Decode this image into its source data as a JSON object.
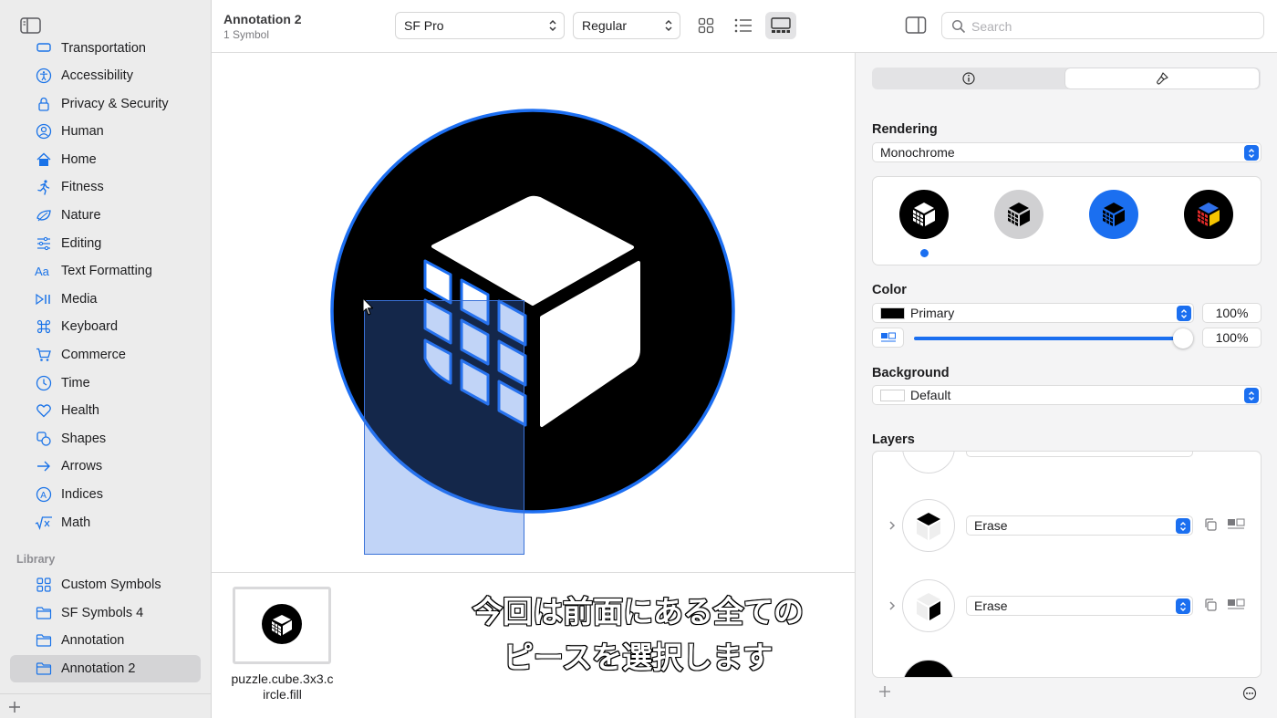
{
  "colors": {
    "accent": "#1b6ff0",
    "sidebar_bg": "#ececec",
    "selection": "#d4d4d6"
  },
  "sidebar": {
    "top_partial_label": "Transportation",
    "categories": [
      {
        "label": "Accessibility",
        "icon": "accessibility-icon"
      },
      {
        "label": "Privacy & Security",
        "icon": "lock-icon"
      },
      {
        "label": "Human",
        "icon": "person-circle-icon"
      },
      {
        "label": "Home",
        "icon": "house-icon"
      },
      {
        "label": "Fitness",
        "icon": "figure-run-icon"
      },
      {
        "label": "Nature",
        "icon": "leaf-icon"
      },
      {
        "label": "Editing",
        "icon": "sliders-icon"
      },
      {
        "label": "Text Formatting",
        "icon": "textformat-icon"
      },
      {
        "label": "Media",
        "icon": "playpause-icon"
      },
      {
        "label": "Keyboard",
        "icon": "command-icon"
      },
      {
        "label": "Commerce",
        "icon": "cart-icon"
      },
      {
        "label": "Time",
        "icon": "clock-icon"
      },
      {
        "label": "Health",
        "icon": "heart-icon"
      },
      {
        "label": "Shapes",
        "icon": "shapes-icon"
      },
      {
        "label": "Arrows",
        "icon": "arrow-right-icon"
      },
      {
        "label": "Indices",
        "icon": "a-circle-icon"
      },
      {
        "label": "Math",
        "icon": "sqrt-icon"
      }
    ],
    "library_header": "Library",
    "library": [
      {
        "label": "Custom Symbols",
        "icon": "grid-icon"
      },
      {
        "label": "SF Symbols 4",
        "icon": "folder-icon"
      },
      {
        "label": "Annotation",
        "icon": "folder-icon"
      },
      {
        "label": "Annotation 2",
        "icon": "folder-icon",
        "selected": true
      }
    ]
  },
  "toolbar": {
    "title": "Annotation 2",
    "subtitle": "1 Symbol",
    "font": "SF Pro",
    "weight": "Regular",
    "search_placeholder": "Search"
  },
  "gallery": {
    "symbol_name": "puzzle.cube.3x3.circle.fill"
  },
  "caption": {
    "line1": "今回は前面にある全ての",
    "line2": "ピースを選択します"
  },
  "inspector": {
    "rendering_label": "Rendering",
    "rendering_mode": "Monochrome",
    "color_label": "Color",
    "color_value": "Primary",
    "color_percent": "100%",
    "opacity_percent": "100%",
    "opacity": 1.0,
    "background_label": "Background",
    "background_value": "Default",
    "layers_label": "Layers",
    "layers": [
      {
        "mode": "Erase"
      },
      {
        "mode": "Erase"
      }
    ]
  }
}
